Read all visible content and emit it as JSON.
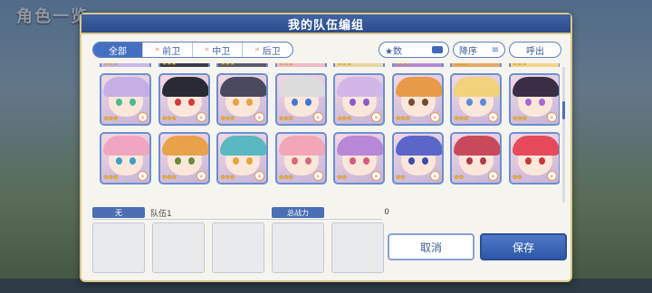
{
  "background": {
    "title": "角色一览"
  },
  "modal": {
    "title": "我的队伍编组"
  },
  "filters": {
    "tabs": [
      {
        "label": "全部",
        "active": true
      },
      {
        "label": "前卫",
        "active": false
      },
      {
        "label": "中卫",
        "active": false
      },
      {
        "label": "后卫",
        "active": false
      }
    ],
    "sort_field": "★数",
    "sort_order": "降序",
    "callout": "呼出"
  },
  "characters": [
    {
      "id": "c1",
      "stars": "★★★",
      "hair": "#c8b6e8",
      "eyes": "#6cc8a8",
      "partial": true
    },
    {
      "id": "c2",
      "stars": "★★★",
      "hair": "#3a3a4a",
      "eyes": "#d84a4a",
      "partial": true
    },
    {
      "id": "c3",
      "stars": "★★★",
      "hair": "#5c5b6c",
      "eyes": "#e6a43a",
      "partial": true
    },
    {
      "id": "c4",
      "stars": "★★★",
      "hair": "#f0b9c9",
      "eyes": "#6a9de0",
      "partial": true
    },
    {
      "id": "c5",
      "stars": "★★★",
      "hair": "#e8d7a0",
      "eyes": "#6a9de0",
      "partial": true
    },
    {
      "id": "c6",
      "stars": "★★★",
      "hair": "#b38ad6",
      "eyes": "#8a6cd8",
      "partial": true
    },
    {
      "id": "c7",
      "stars": "★★★",
      "hair": "#e6a86a",
      "eyes": "#a4673a",
      "partial": true
    },
    {
      "id": "c8",
      "stars": "★★★",
      "hair": "#f2d58a",
      "eyes": "#6a9de0",
      "partial": true
    },
    {
      "id": "c9",
      "stars": "★★★",
      "hair": "#c6aee6",
      "eyes": "#4bb890"
    },
    {
      "id": "c10",
      "stars": "★★★",
      "hair": "#2a2a34",
      "eyes": "#d63a3a"
    },
    {
      "id": "c11",
      "stars": "★★★",
      "hair": "#4a4a5e",
      "eyes": "#e8a23a"
    },
    {
      "id": "c12",
      "stars": "★★★",
      "hair": "#dcdcdc",
      "eyes": "#3a7ad6"
    },
    {
      "id": "c13",
      "stars": "★★★",
      "hair": "#d2b6e8",
      "eyes": "#8a5ad0"
    },
    {
      "id": "c14",
      "stars": "★★★",
      "hair": "#e89a4a",
      "eyes": "#7a4a2a"
    },
    {
      "id": "c15",
      "stars": "★★★",
      "hair": "#f2d27a",
      "eyes": "#5a8ad8"
    },
    {
      "id": "c16",
      "stars": "★★★",
      "hair": "#3a2e46",
      "eyes": "#a46ad6"
    },
    {
      "id": "c17",
      "stars": "★★★",
      "hair": "#f0a6c0",
      "eyes": "#3aa0c8"
    },
    {
      "id": "c18",
      "stars": "★★★",
      "hair": "#e8a24a",
      "eyes": "#6a8a3a"
    },
    {
      "id": "c19",
      "stars": "★★★",
      "hair": "#5ab8c0",
      "eyes": "#e6a43a"
    },
    {
      "id": "c20",
      "stars": "★★★",
      "hair": "#f2a6b6",
      "eyes": "#d66a7a"
    },
    {
      "id": "c21",
      "stars": "★★",
      "hair": "#b888d6",
      "eyes": "#d65a7a"
    },
    {
      "id": "c22",
      "stars": "★★",
      "hair": "#5a66c8",
      "eyes": "#3a4ab0"
    },
    {
      "id": "c23",
      "stars": "★★",
      "hair": "#c84a5a",
      "eyes": "#b03a4a"
    },
    {
      "id": "c24",
      "stars": "★★",
      "hair": "#e64a5a",
      "eyes": "#c43a3a"
    }
  ],
  "team": {
    "badge": "无",
    "name": "队伍1",
    "power_label": "总战力",
    "power_value": "0"
  },
  "buttons": {
    "cancel": "取消",
    "save": "保存"
  }
}
